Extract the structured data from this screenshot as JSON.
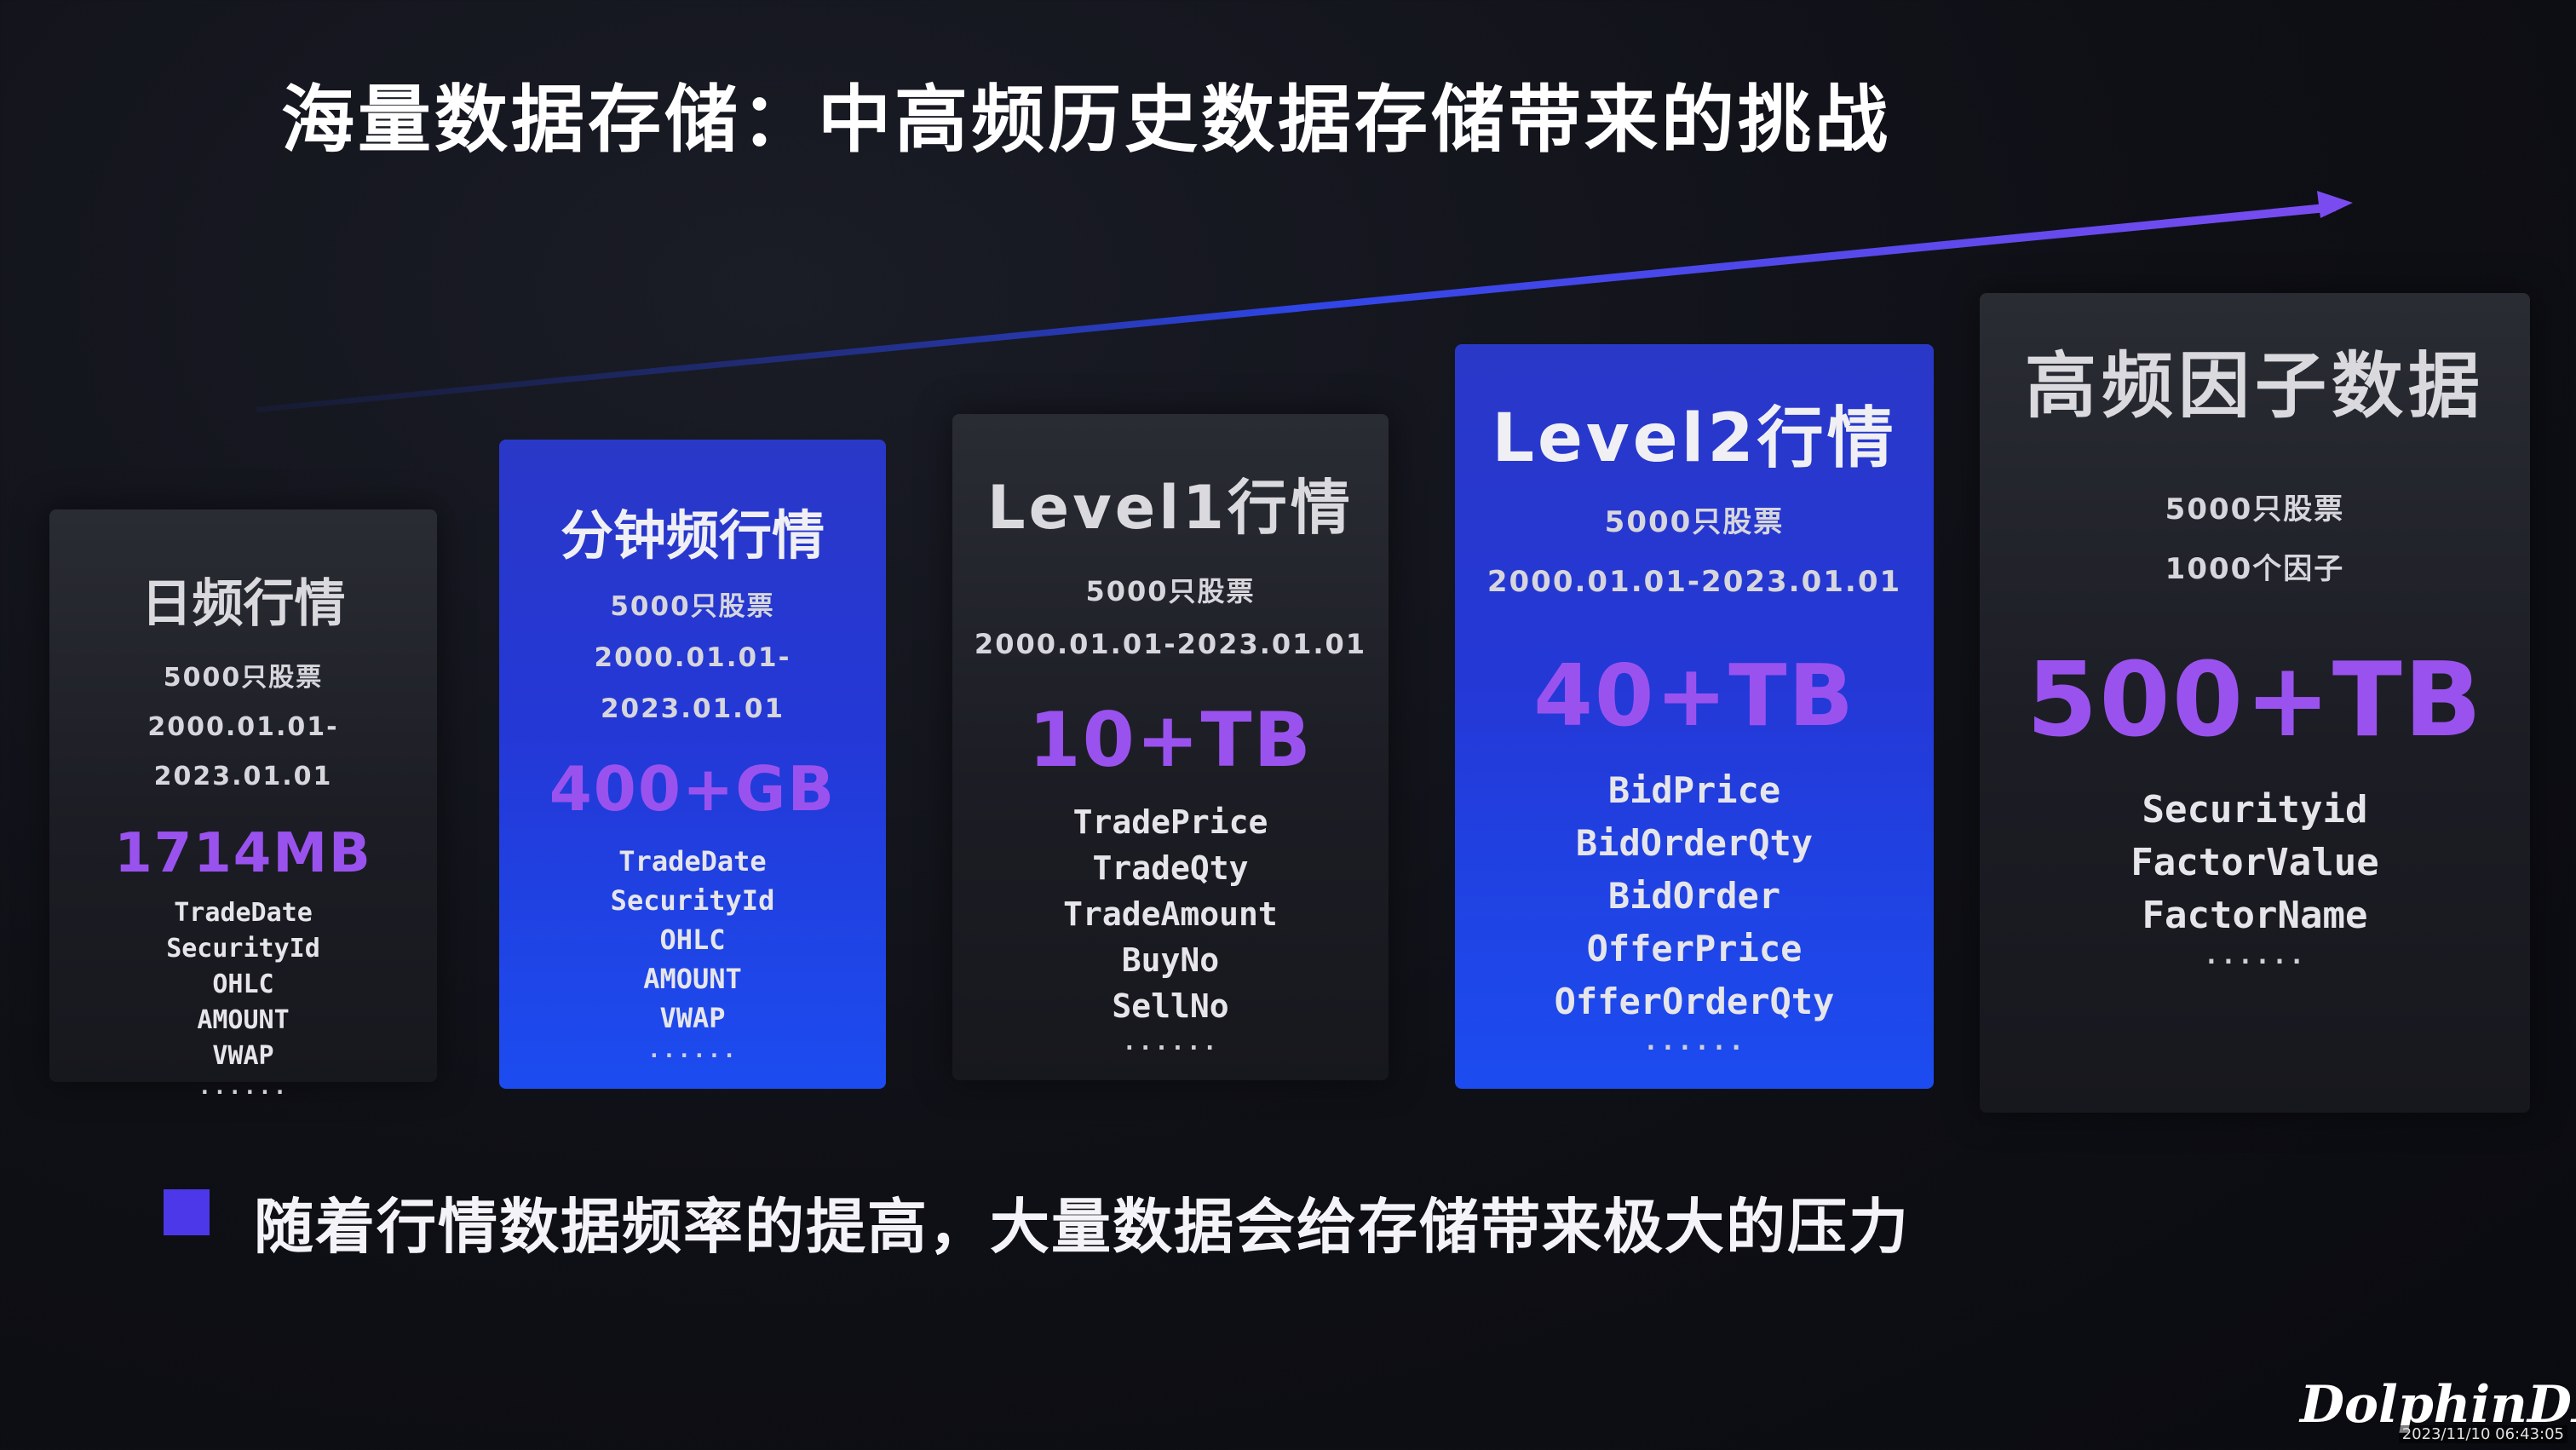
{
  "title": "海量数据存储：中高频历史数据存储带来的挑战",
  "colors": {
    "arrow_start": "#1a2a7a",
    "arrow_mid": "#2f45e6",
    "arrow_end": "#7a4cf0",
    "size_text": "#9a52ee",
    "bullet": "#4c38e8"
  },
  "cards": [
    {
      "name": "日频行情",
      "meta": [
        "5000只股票",
        "2000.01.01-",
        "2023.01.01"
      ],
      "size": "1714MB",
      "fields": [
        "TradeDate",
        "SecurityId",
        "OHLC",
        "AMOUNT",
        "VWAP"
      ],
      "more": "......"
    },
    {
      "name": "分钟频行情",
      "meta": [
        "5000只股票",
        "2000.01.01-",
        "2023.01.01"
      ],
      "size": "400+GB",
      "fields": [
        "TradeDate",
        "SecurityId",
        "OHLC",
        "AMOUNT",
        "VWAP"
      ],
      "more": "......"
    },
    {
      "name": "Level1行情",
      "meta": [
        "5000只股票",
        "2000.01.01-2023.01.01"
      ],
      "size": "10+TB",
      "fields": [
        "TradePrice",
        "TradeQty",
        "TradeAmount",
        "BuyNo",
        "SellNo"
      ],
      "more": "......"
    },
    {
      "name": "Level2行情",
      "meta": [
        "5000只股票",
        "2000.01.01-2023.01.01"
      ],
      "size": "40+TB",
      "fields": [
        "BidPrice",
        "BidOrderQty",
        "BidOrder",
        "OfferPrice",
        "OfferOrderQty"
      ],
      "more": "......"
    },
    {
      "name": "高频因子数据",
      "meta": [
        "5000只股票",
        "1000个因子"
      ],
      "size": "500+TB",
      "fields": [
        "Securityid",
        "FactorValue",
        "FactorName"
      ],
      "more": "......"
    }
  ],
  "bullet": "随着行情数据频率的提高，大量数据会给存储带来极大的压力",
  "logo": "DolphinDB",
  "timestamp": "2023/11/10 06:43:05"
}
